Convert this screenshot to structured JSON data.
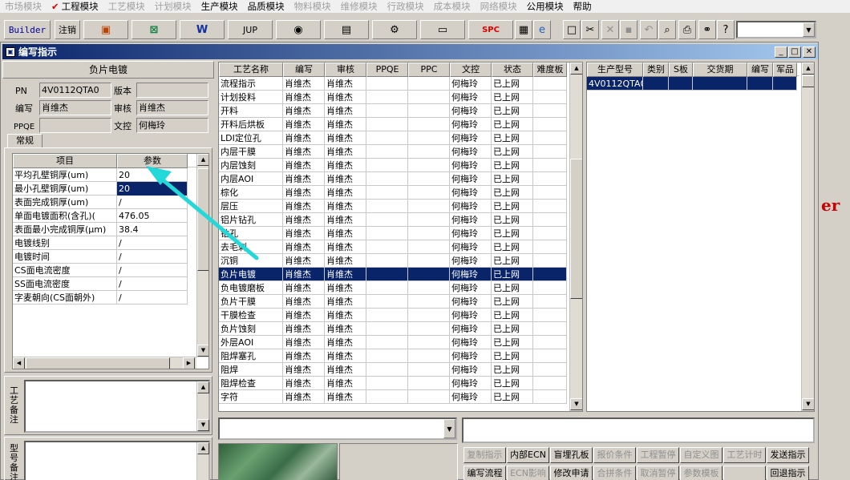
{
  "menubar": {
    "items": [
      {
        "label": "市场模块",
        "enabled": false
      },
      {
        "label": "工程模块",
        "enabled": true,
        "checked": true
      },
      {
        "label": "工艺模块",
        "enabled": false
      },
      {
        "label": "计划模块",
        "enabled": false
      },
      {
        "label": "生产模块",
        "enabled": true
      },
      {
        "label": "品质模块",
        "enabled": true
      },
      {
        "label": "物料模块",
        "enabled": false
      },
      {
        "label": "维修模块",
        "enabled": false
      },
      {
        "label": "行政模块",
        "enabled": false
      },
      {
        "label": "成本模块",
        "enabled": false
      },
      {
        "label": "网络模块",
        "enabled": false
      },
      {
        "label": "公用模块",
        "enabled": true
      },
      {
        "label": "帮助",
        "enabled": true
      }
    ]
  },
  "toolbar": {
    "builder": "Builder",
    "logout": "注销",
    "jup": "JUP",
    "spc": "SPC"
  },
  "window": {
    "title": "编写指示"
  },
  "left": {
    "header": "负片电镀",
    "pn_label": "PN",
    "pn_value": "4V0112QTA0",
    "version_label": "版本",
    "version_value": "",
    "author_label": "编写",
    "author_value": "肖维杰",
    "review_label": "审核",
    "review_value": "肖维杰",
    "ppqe_label": "PPQE",
    "ppqe_value": "",
    "control_label": "文控",
    "control_value": "何梅玲",
    "tab_label": "常规",
    "param_headers": [
      "项目",
      "参数"
    ],
    "params": [
      {
        "item": "平均孔壁铜厚(um)",
        "value": "20"
      },
      {
        "item": "最小孔壁铜厚(um)",
        "value": "20"
      },
      {
        "item": "表面完成铜厚(um)",
        "value": "/"
      },
      {
        "item": "单面电镀面积(含孔)(",
        "value": "476.05"
      },
      {
        "item": "表面最小完成铜厚(μm)",
        "value": "38.4"
      },
      {
        "item": "电镀线别",
        "value": "/"
      },
      {
        "item": "电镀时间",
        "value": "/"
      },
      {
        "item": "CS面电流密度",
        "value": "/"
      },
      {
        "item": "SS面电流密度",
        "value": "/"
      },
      {
        "item": "字麦朝向(CS面朝外)",
        "value": "/"
      }
    ],
    "process_note_label": "工艺备注",
    "model_note_label": "型号备注"
  },
  "process_grid": {
    "headers": [
      "工艺名称",
      "编写",
      "审核",
      "PPQE",
      "PPC",
      "文控",
      "状态",
      "难度板"
    ],
    "rows": [
      [
        "流程指示",
        "肖维杰",
        "肖维杰",
        "",
        "",
        "何梅玲",
        "已上网",
        ""
      ],
      [
        "计划投料",
        "肖维杰",
        "肖维杰",
        "",
        "",
        "何梅玲",
        "已上网",
        ""
      ],
      [
        "开料",
        "肖维杰",
        "肖维杰",
        "",
        "",
        "何梅玲",
        "已上网",
        ""
      ],
      [
        "开料后烘板",
        "肖维杰",
        "肖维杰",
        "",
        "",
        "何梅玲",
        "已上网",
        ""
      ],
      [
        "LDI定位孔",
        "肖维杰",
        "肖维杰",
        "",
        "",
        "何梅玲",
        "已上网",
        ""
      ],
      [
        "内层干膜",
        "肖维杰",
        "肖维杰",
        "",
        "",
        "何梅玲",
        "已上网",
        ""
      ],
      [
        "内层蚀刻",
        "肖维杰",
        "肖维杰",
        "",
        "",
        "何梅玲",
        "已上网",
        ""
      ],
      [
        "内层AOI",
        "肖维杰",
        "肖维杰",
        "",
        "",
        "何梅玲",
        "已上网",
        ""
      ],
      [
        "棕化",
        "肖维杰",
        "肖维杰",
        "",
        "",
        "何梅玲",
        "已上网",
        ""
      ],
      [
        "层压",
        "肖维杰",
        "肖维杰",
        "",
        "",
        "何梅玲",
        "已上网",
        ""
      ],
      [
        "铝片钻孔",
        "肖维杰",
        "肖维杰",
        "",
        "",
        "何梅玲",
        "已上网",
        ""
      ],
      [
        "钻孔",
        "肖维杰",
        "肖维杰",
        "",
        "",
        "何梅玲",
        "已上网",
        ""
      ],
      [
        "去毛刺",
        "肖维杰",
        "肖维杰",
        "",
        "",
        "何梅玲",
        "已上网",
        ""
      ],
      [
        "沉铜",
        "肖维杰",
        "肖维杰",
        "",
        "",
        "何梅玲",
        "已上网",
        ""
      ],
      [
        "负片电镀",
        "肖维杰",
        "肖维杰",
        "",
        "",
        "何梅玲",
        "已上网",
        ""
      ],
      [
        "负电镀磨板",
        "肖维杰",
        "肖维杰",
        "",
        "",
        "何梅玲",
        "已上网",
        ""
      ],
      [
        "负片干膜",
        "肖维杰",
        "肖维杰",
        "",
        "",
        "何梅玲",
        "已上网",
        ""
      ],
      [
        "干膜检查",
        "肖维杰",
        "肖维杰",
        "",
        "",
        "何梅玲",
        "已上网",
        ""
      ],
      [
        "负片蚀刻",
        "肖维杰",
        "肖维杰",
        "",
        "",
        "何梅玲",
        "已上网",
        ""
      ],
      [
        "外层AOI",
        "肖维杰",
        "肖维杰",
        "",
        "",
        "何梅玲",
        "已上网",
        ""
      ],
      [
        "阻焊塞孔",
        "肖维杰",
        "肖维杰",
        "",
        "",
        "何梅玲",
        "已上网",
        ""
      ],
      [
        "阻焊",
        "肖维杰",
        "肖维杰",
        "",
        "",
        "何梅玲",
        "已上网",
        ""
      ],
      [
        "阻焊检查",
        "肖维杰",
        "肖维杰",
        "",
        "",
        "何梅玲",
        "已上网",
        ""
      ],
      [
        "字符",
        "肖维杰",
        "肖维杰",
        "",
        "",
        "何梅玲",
        "已上网",
        ""
      ]
    ],
    "selected_index": 14
  },
  "model_grid": {
    "headers": [
      "生产型号",
      "类别",
      "S板",
      "交货期",
      "编写",
      "军品"
    ],
    "rows": [
      [
        "4V0112QTA0",
        "",
        "",
        "",
        "",
        ""
      ]
    ]
  },
  "buttons": {
    "row1": [
      {
        "label": "复制指示",
        "enabled": false
      },
      {
        "label": "内部ECN",
        "enabled": true
      },
      {
        "label": "盲埋孔板",
        "enabled": true
      },
      {
        "label": "报价条件",
        "enabled": false
      },
      {
        "label": "工程暂停",
        "enabled": false
      },
      {
        "label": "自定义图",
        "enabled": false
      },
      {
        "label": "工艺计时",
        "enabled": false
      },
      {
        "label": "发送指示",
        "enabled": true
      }
    ],
    "row2": [
      {
        "label": "编写流程",
        "enabled": true
      },
      {
        "label": "ECN影响",
        "enabled": false
      },
      {
        "label": "修改申请",
        "enabled": true
      },
      {
        "label": "合拼条件",
        "enabled": false
      },
      {
        "label": "取消暂停",
        "enabled": false
      },
      {
        "label": "参数模板",
        "enabled": false
      },
      {
        "label": "",
        "enabled": false
      },
      {
        "label": "回退指示",
        "enabled": true
      }
    ]
  },
  "background": {
    "fragment": "er"
  },
  "colors": {
    "selection": "#0a246a",
    "titlebar": "#0a246a",
    "annotation_arrow": "#22d8d8",
    "menu_check": "#e00000",
    "background_fragment": "#cc0000"
  }
}
